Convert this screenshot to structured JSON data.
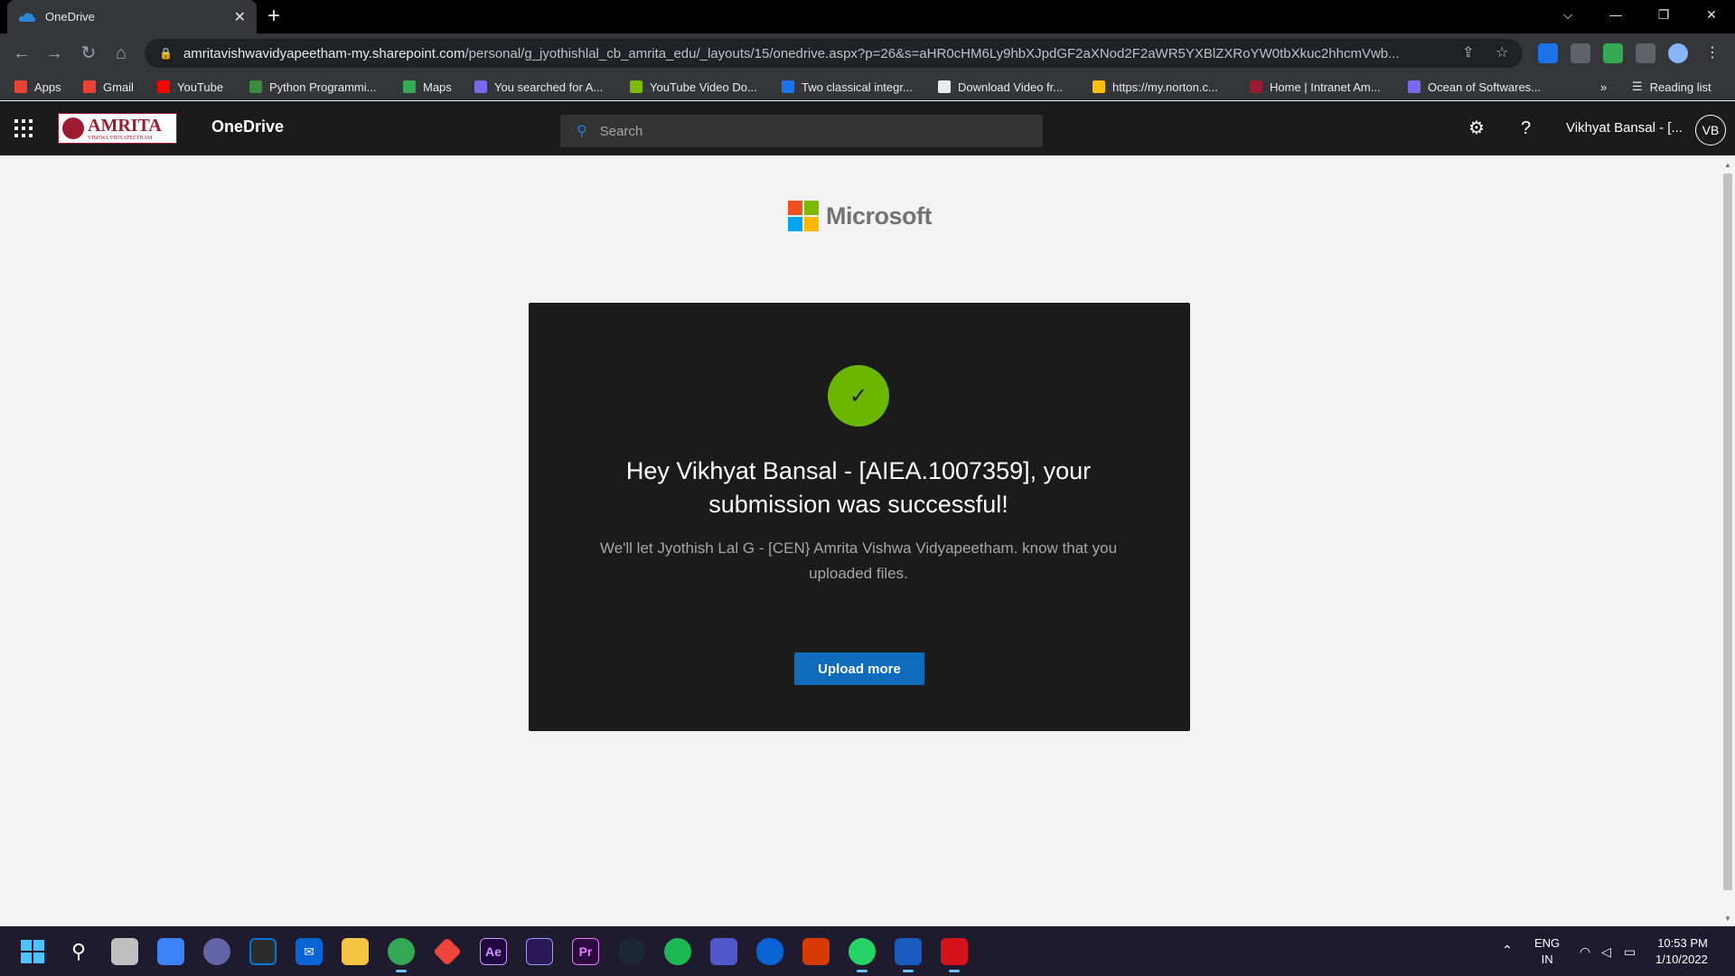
{
  "browser": {
    "tab_title": "OneDrive",
    "url_domain": "amritavishwavidyapeetham-my.sharepoint.com",
    "url_path": "/personal/g_jyothishlal_cb_amrita_edu/_layouts/15/onedrive.aspx?p=26&s=aHR0cHM6Ly9hbXJpdGF2aXNod2F2aWR5YXBlZXRoYW0tbXkuc2hhcmVwb...",
    "bookmarks": [
      {
        "label": "Apps",
        "color": "#ea4335"
      },
      {
        "label": "Gmail",
        "color": "#ea4335"
      },
      {
        "label": "YouTube",
        "color": "#ff0000"
      },
      {
        "label": "Python Programmi...",
        "color": "#3c8c40"
      },
      {
        "label": "Maps",
        "color": "#34a853"
      },
      {
        "label": "You searched for A...",
        "color": "#7b68ee"
      },
      {
        "label": "YouTube Video Do...",
        "color": "#7cbb00"
      },
      {
        "label": "Two classical integr...",
        "color": "#1a73e8"
      },
      {
        "label": "Download Video fr...",
        "color": "#e8eaed"
      },
      {
        "label": "https://my.norton.c...",
        "color": "#ffc107"
      },
      {
        "label": "Home | Intranet Am...",
        "color": "#9b1b30"
      },
      {
        "label": "Ocean of Softwares...",
        "color": "#7b68ee"
      }
    ],
    "reading_list": "Reading list"
  },
  "appbar": {
    "logo_text": "AMRITA",
    "logo_sub": "VISHWA VIDYAPEETHAM",
    "app_name": "OneDrive",
    "search_placeholder": "Search",
    "user_name": "Vikhyat Bansal - [...",
    "avatar_initials": "VB"
  },
  "page": {
    "ms_brand": "Microsoft",
    "headline": "Hey Vikhyat Bansal - [AIEA.1007359], your submission was successful!",
    "subline": "We'll let Jyothish Lal G - [CEN} Amrita Vishwa Vidyapeetham. know that you uploaded files.",
    "upload_button": "Upload more"
  },
  "taskbar": {
    "lang_top": "ENG",
    "lang_bottom": "IN",
    "time": "10:53 PM",
    "date": "1/10/2022",
    "apps": [
      {
        "name": "start-icon",
        "color": "#4cc2ff"
      },
      {
        "name": "search-icon",
        "color": "transparent"
      },
      {
        "name": "task-view-icon",
        "color": "#bfbfbf"
      },
      {
        "name": "widgets-icon",
        "color": "#3b82f6"
      },
      {
        "name": "chat-icon",
        "color": "#6264a7"
      },
      {
        "name": "store-icon",
        "color": "#2c2c2c"
      },
      {
        "name": "mail-icon",
        "color": "#0a64d6"
      },
      {
        "name": "file-explorer-icon",
        "color": "#f4c542"
      },
      {
        "name": "chrome-icon",
        "color": "#34a853"
      },
      {
        "name": "anydesk-icon",
        "color": "#ef443b"
      },
      {
        "name": "after-effects-icon",
        "color": "#1f0740"
      },
      {
        "name": "premiere-rush-icon",
        "color": "#2b1a57"
      },
      {
        "name": "premiere-pro-icon",
        "color": "#2b0a3d"
      },
      {
        "name": "steam-icon",
        "color": "#1b2838"
      },
      {
        "name": "spotify-icon",
        "color": "#1db954"
      },
      {
        "name": "teams-icon",
        "color": "#5059c9"
      },
      {
        "name": "onedrive-icon",
        "color": "#0a64d6"
      },
      {
        "name": "office-icon",
        "color": "#d83b01"
      },
      {
        "name": "whatsapp-icon",
        "color": "#25d366"
      },
      {
        "name": "word-icon",
        "color": "#185abd"
      },
      {
        "name": "acrobat-icon",
        "color": "#d4141a"
      }
    ],
    "app_labels": {
      "ae": "Ae",
      "pr": "Pr"
    }
  },
  "colors": {
    "accent": "#0f6cbd",
    "success": "#6bb700",
    "card_bg": "#1b1b1b"
  }
}
